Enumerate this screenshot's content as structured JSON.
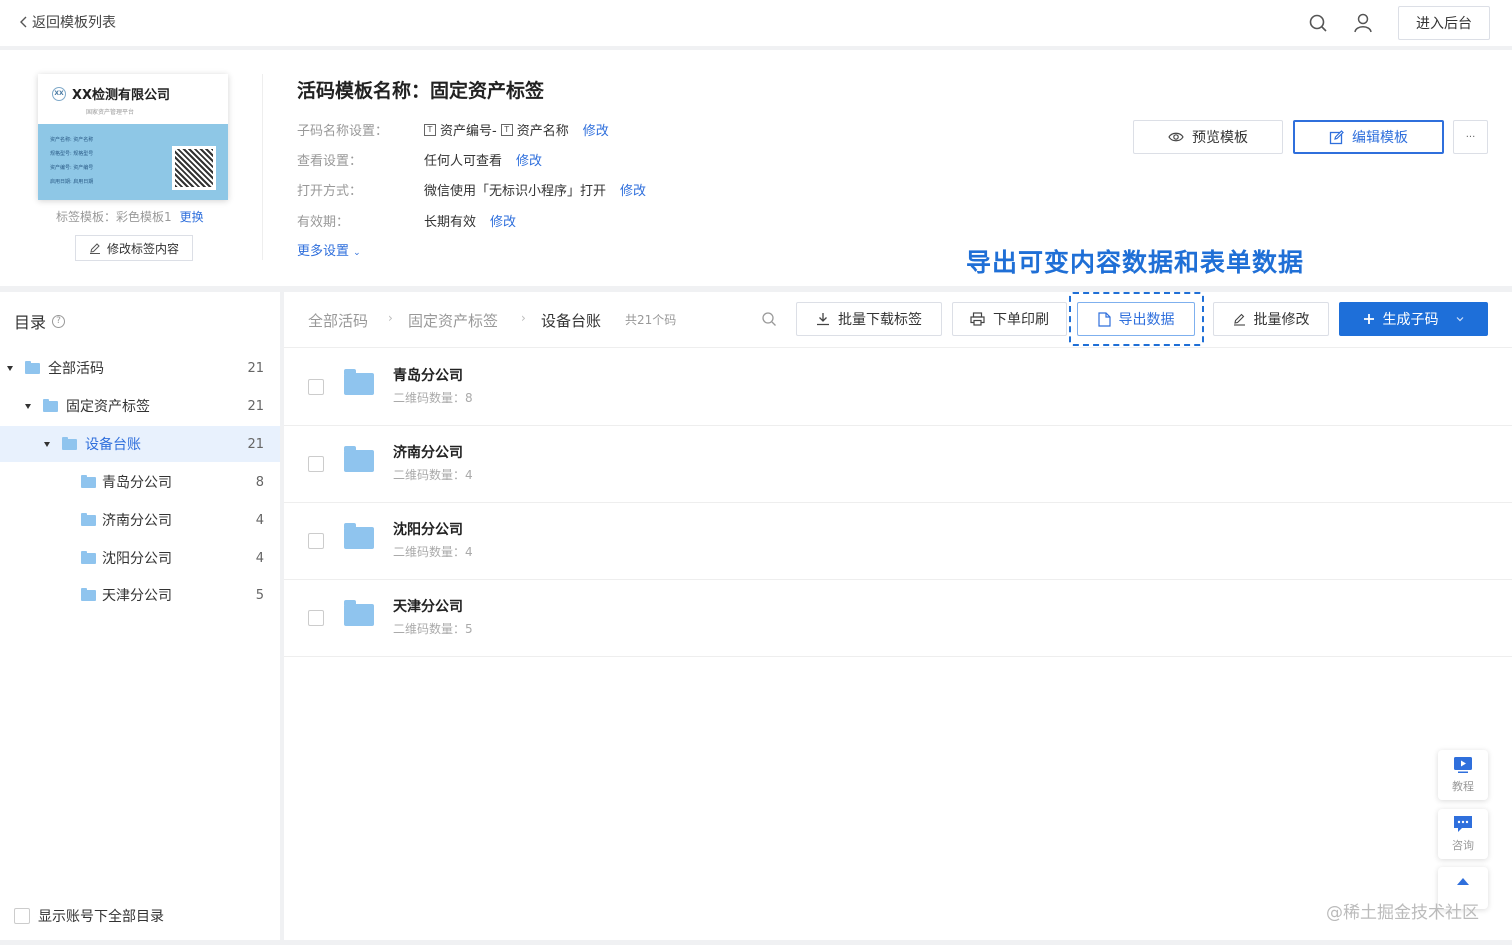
{
  "topbar": {
    "back_label": "返回模板列表",
    "enter_label": "进入后台",
    "icons": [
      "search-icon",
      "user-icon"
    ]
  },
  "label_preview": {
    "company": "XX检测有限公司",
    "logo_text": "XX",
    "subtitle": "国家资产管理平台",
    "fields": [
      "资产名称: 资产名称",
      "规格型号: 规格型号",
      "资产编号: 资产编号",
      "启用日期: 启用日期"
    ],
    "template_label": "标签模板：彩色模板1",
    "change_label": "更换",
    "edit_content_label": "修改标签内容"
  },
  "template": {
    "name": "活码模板名称：固定资产标签",
    "rows": [
      {
        "key": "子码名称设置：",
        "value": "资产编号-",
        "value2": "资产名称",
        "action": "修改"
      },
      {
        "key": "查看设置：",
        "value": "任何人可查看",
        "action": "修改"
      },
      {
        "key": "打开方式：",
        "value": "微信使用「无标识小程序」打开",
        "action": "修改"
      },
      {
        "key": "有效期：",
        "value": "长期有效",
        "action": "修改"
      }
    ],
    "tbox_glyph": "T",
    "more_settings": "更多设置",
    "preview_label": "预览模板",
    "edit_label": "编辑模板",
    "more_label": "···"
  },
  "callout": "导出可变内容数据和表单数据",
  "sidebar": {
    "title": "目录",
    "help_glyph": "?",
    "tree": [
      {
        "label": "全部活码",
        "count": "21"
      },
      {
        "label": "固定资产标签",
        "count": "21"
      },
      {
        "label": "设备台账",
        "count": "21"
      },
      {
        "label": "青岛分公司",
        "count": "8"
      },
      {
        "label": "济南分公司",
        "count": "4"
      },
      {
        "label": "沈阳分公司",
        "count": "4"
      },
      {
        "label": "天津分公司",
        "count": "5"
      }
    ],
    "footer_label": "显示账号下全部目录"
  },
  "main": {
    "breadcrumb": [
      "全部活码",
      "固定资产标签",
      "设备台账"
    ],
    "crumb_sep": "›",
    "total": "共21个码",
    "buttons": {
      "batch_download": "批量下载标签",
      "order_print": "下单印刷",
      "export": "导出数据",
      "batch_edit": "批量修改",
      "generate": "生成子码"
    },
    "rows": [
      {
        "name": "青岛分公司",
        "sub": "二维码数量：8"
      },
      {
        "name": "济南分公司",
        "sub": "二维码数量：4"
      },
      {
        "name": "沈阳分公司",
        "sub": "二维码数量：4"
      },
      {
        "name": "天津分公司",
        "sub": "二维码数量：5"
      }
    ]
  },
  "floating": {
    "tutorial": "教程",
    "consult": "咨询"
  },
  "watermark": "@稀土掘金技术社区",
  "colors": {
    "accent": "#2f6fdc",
    "primary": "#1e6fd9",
    "callout": "#1f6fd6",
    "folder": "#8fc4ee"
  }
}
